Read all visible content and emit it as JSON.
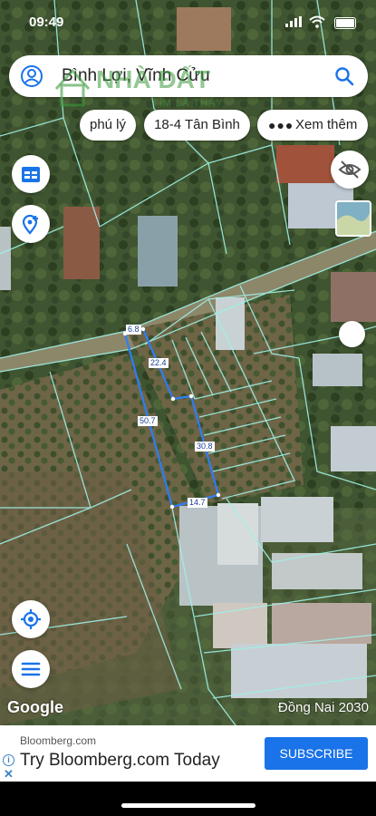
{
  "status_bar": {
    "time": "09:49"
  },
  "search": {
    "query": "Bình Lợi, Vĩnh Cửu"
  },
  "chips": [
    "phú lý",
    "18-4 Tân Bình",
    "Xem thêm"
  ],
  "parcel_labels": [
    "6.8",
    "22.4",
    "50.7",
    "30.8",
    "14.7"
  ],
  "map": {
    "attribution": "Google",
    "layer_label": "Đồng Nai 2030",
    "parcel_color": "#2f7df6",
    "boundary_color": "#9ff0e6"
  },
  "watermark": {
    "brand": "NHÀ ĐẤT",
    "tagline": "TÌM LÀ THẤY"
  },
  "ad": {
    "source": "Bloomberg.com",
    "headline": "Try Bloomberg.com Today",
    "cta": "SUBSCRIBE"
  },
  "icons": [
    "user-icon",
    "search-icon",
    "calendar-icon",
    "add-location-icon",
    "eye-off-icon",
    "my-location-icon",
    "menu-icon",
    "info-icon",
    "close-icon"
  ]
}
